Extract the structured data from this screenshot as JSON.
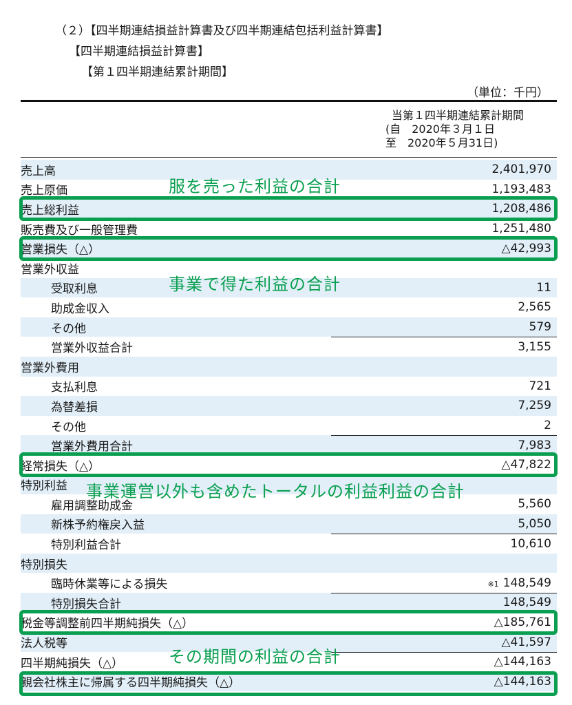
{
  "heading": {
    "line1": "（２）【四半期連結損益計算書及び四半期連結包括利益計算書】",
    "line2": "【四半期連結損益計算書】",
    "line3": "【第１四半期連結累計期間】",
    "unit": "（単位：千円）"
  },
  "period": {
    "line1": "当第１四半期連結累計期間",
    "line2": "(自　2020年３月１日",
    "line3": "至　2020年５月31日)"
  },
  "rows": [
    {
      "label": "売上高",
      "value": "2,401,970"
    },
    {
      "label": "売上原価",
      "value": "1,193,483"
    },
    {
      "label": "売上総利益",
      "value": "1,208,486"
    },
    {
      "label": "販売費及び一般管理費",
      "value": "1,251,480"
    },
    {
      "label": "営業損失（△）",
      "value": "△42,993"
    },
    {
      "label": "営業外収益",
      "value": ""
    },
    {
      "label": "受取利息",
      "value": "11"
    },
    {
      "label": "助成金収入",
      "value": "2,565"
    },
    {
      "label": "その他",
      "value": "579"
    },
    {
      "label": "営業外収益合計",
      "value": "3,155"
    },
    {
      "label": "営業外費用",
      "value": ""
    },
    {
      "label": "支払利息",
      "value": "721"
    },
    {
      "label": "為替差損",
      "value": "7,259"
    },
    {
      "label": "その他",
      "value": "2"
    },
    {
      "label": "営業外費用合計",
      "value": "7,983"
    },
    {
      "label": "経常損失（△）",
      "value": "△47,822"
    },
    {
      "label": "特別利益",
      "value": ""
    },
    {
      "label": "雇用調整助成金",
      "value": "5,560"
    },
    {
      "label": "新株予約権戻入益",
      "value": "5,050"
    },
    {
      "label": "特別利益合計",
      "value": "10,610"
    },
    {
      "label": "特別損失",
      "value": ""
    },
    {
      "label": "臨時休業等による損失",
      "value": "148,549",
      "note": "※1"
    },
    {
      "label": "特別損失合計",
      "value": "148,549"
    },
    {
      "label": "税金等調整前四半期純損失（△）",
      "value": "△185,761"
    },
    {
      "label": "法人税等",
      "value": "△41,597"
    },
    {
      "label": "四半期純損失（△）",
      "value": "△144,163"
    },
    {
      "label": "親会社株主に帰属する四半期純損失（△）",
      "value": "△144,163"
    }
  ],
  "annotations": {
    "gross": "服を売った利益の合計",
    "operating": "事業で得た利益の合計",
    "ordinary": "事業運営以外も含めたトータルの利益利益の合計",
    "net": "その期間の利益の合計"
  },
  "accent_color": "#0a9f50",
  "shade_color": "#e2eff8"
}
